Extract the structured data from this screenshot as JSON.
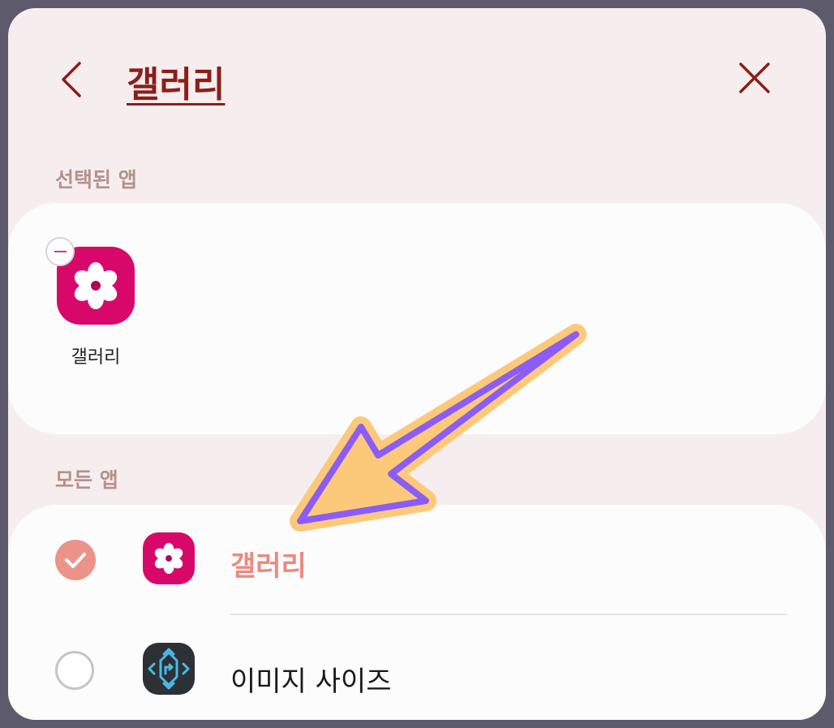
{
  "header": {
    "title": "갤러리"
  },
  "sections": {
    "selected_label": "선택된 앱",
    "all_label": "모든 앱"
  },
  "selected_apps": [
    {
      "label": "갤러리",
      "icon": "gallery-flower-icon"
    }
  ],
  "all_apps": [
    {
      "label": "갤러리",
      "checked": true,
      "icon": "gallery-flower-icon"
    },
    {
      "label": "이미지 사이즈",
      "checked": false,
      "icon": "image-resize-icon"
    }
  ],
  "colors": {
    "title": "#8a1f1a",
    "gallery_icon": "#d8086b",
    "checked": "#ec9389",
    "arrow_fill": "#fcc97a",
    "arrow_outline": "#8b5cf6"
  }
}
